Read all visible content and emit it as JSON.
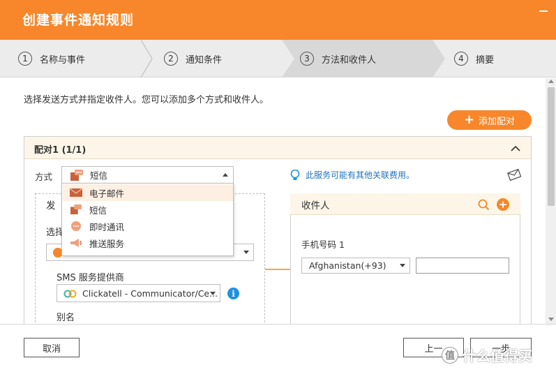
{
  "window": {
    "title": "创建事件通知规则"
  },
  "steps": [
    {
      "num": "1",
      "label": "名称与事件"
    },
    {
      "num": "2",
      "label": "通知条件"
    },
    {
      "num": "3",
      "label": "方法和收件人"
    },
    {
      "num": "4",
      "label": "摘要"
    }
  ],
  "intro": "选择发送方式并指定收件人。您可以添加多个方式和收件人。",
  "add_pair_label": "添加配对",
  "pair": {
    "title": "配对1 (1/1)",
    "method_label": "方式",
    "method_value": "短信",
    "method_options": [
      "电子邮件",
      "短信",
      "即时通讯",
      "推送服务"
    ],
    "notice": "此服务可能有其他关联费用。"
  },
  "sender": {
    "title_visible": "发",
    "select_label_visible": "选择",
    "sms_provider_label": "SMS 服务提供商",
    "sms_provider_value": "Clickatell - Communicator/Ce...",
    "alias_label": "别名"
  },
  "recipient": {
    "title": "收件人",
    "phone_label": "手机号码 1",
    "country_value": "Afghanistan(+93)",
    "phone_value": ""
  },
  "footer": {
    "cancel": "取消",
    "prev_visible": "上一",
    "next_visible": "一步"
  },
  "watermark": {
    "text": "什么值得买",
    "logo": "值"
  },
  "icons": {
    "minimize": "minimize-icon",
    "collapse": "chevron-up-icon",
    "notice": "bulb-icon",
    "envelope": "envelope-icon",
    "search_user": "search-user-icon",
    "add_recipient": "plus-circle-icon",
    "info": "info-icon"
  },
  "colors": {
    "brand": "#f7872a",
    "link": "#1e73be",
    "info": "#1e90e0"
  }
}
